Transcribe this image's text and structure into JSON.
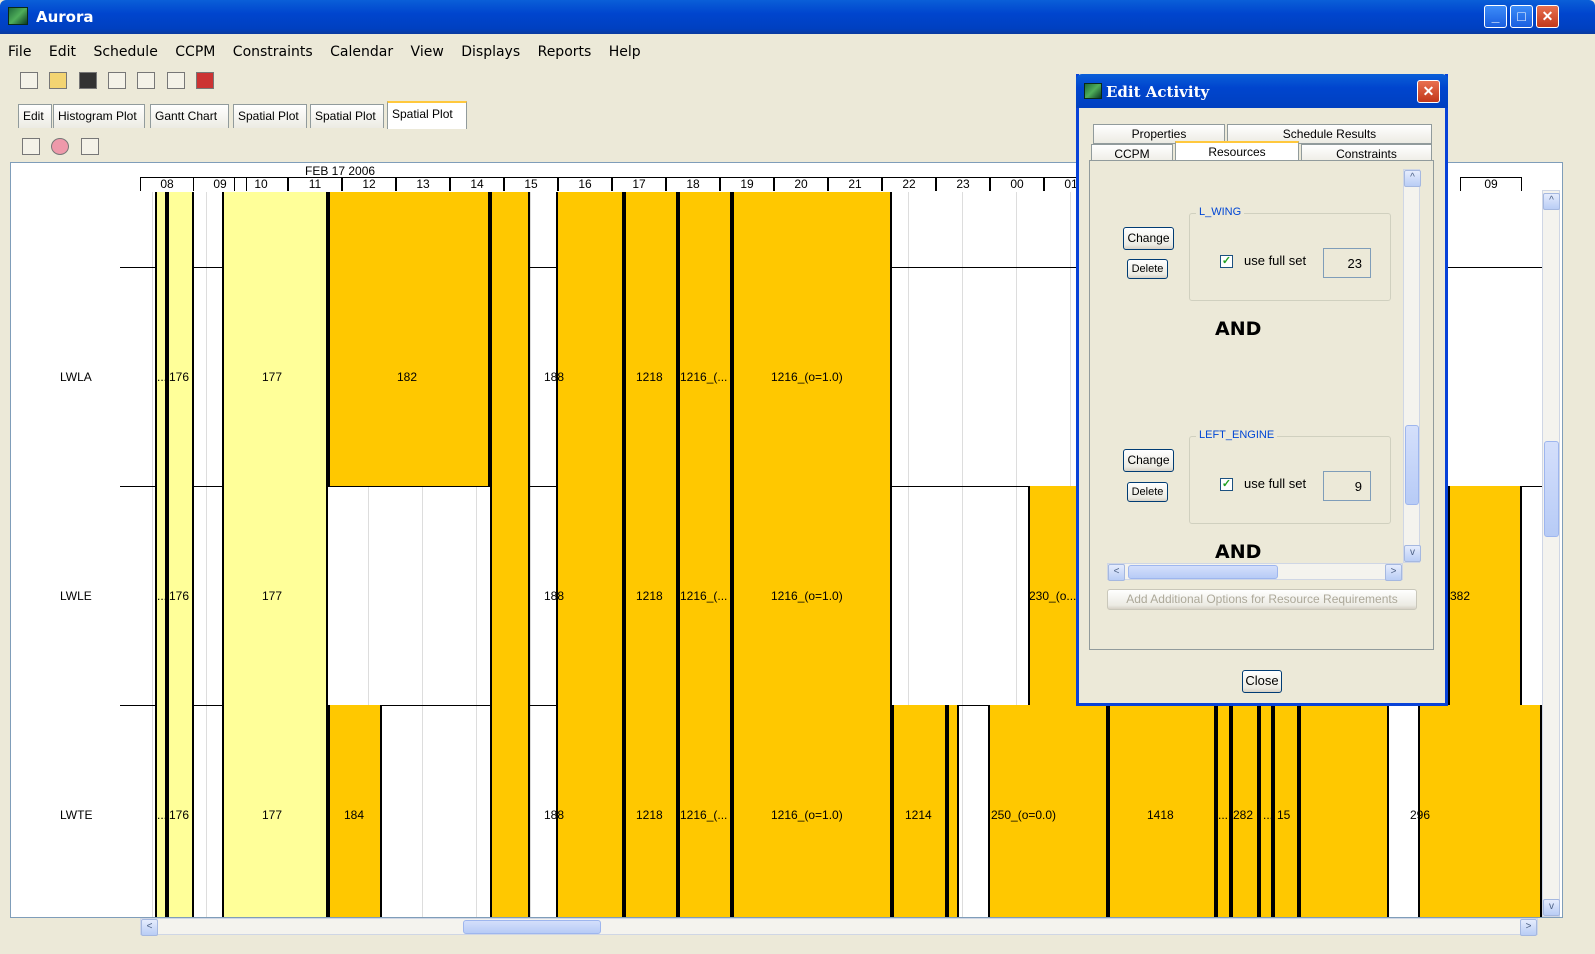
{
  "window": {
    "title": "Aurora"
  },
  "menu": [
    "File",
    "Edit",
    "Schedule",
    "CCPM",
    "Constraints",
    "Calendar",
    "View",
    "Displays",
    "Reports",
    "Help"
  ],
  "tabs": [
    "Edit",
    "Histogram Plot",
    "Gantt Chart",
    "Spatial Plot",
    "Spatial Plot",
    "Spatial Plot"
  ],
  "active_tab": "Spatial Plot",
  "plot": {
    "date": "FEB 17 2006",
    "hours": [
      "08",
      "09",
      "10",
      "11",
      "12",
      "13",
      "14",
      "15",
      "16",
      "17",
      "18",
      "19",
      "20",
      "21",
      "22",
      "23",
      "00",
      "01",
      "09"
    ],
    "rows": [
      {
        "name": "LWLA",
        "labels": [
          "176",
          "177",
          "182",
          "188",
          "1218",
          "1216_(...",
          "1216_(o=1.0)"
        ]
      },
      {
        "name": "LWLE",
        "labels": [
          "176",
          "177",
          "188",
          "1218",
          "1216_(...",
          "1216_(o=1.0)",
          "230_(o...",
          "382"
        ]
      },
      {
        "name": "LWTE",
        "labels": [
          "176",
          "177",
          "184",
          "188",
          "1218",
          "1216_(...",
          "1216_(o=1.0)",
          "1214",
          "250_(o=0.0)",
          "1418",
          "282",
          "15",
          "296"
        ]
      }
    ],
    "truncation_marker": "..."
  },
  "dialog": {
    "title": "Edit Activity",
    "tabs_row1": [
      "Properties",
      "Schedule Results"
    ],
    "tabs_row2": [
      "CCPM",
      "Resources",
      "Constraints"
    ],
    "active_tab": "Resources",
    "resources": [
      {
        "name": "L_WING",
        "change": "Change",
        "delete": "Delete",
        "use_full_set": "use full set",
        "checked": true,
        "value": "23"
      },
      {
        "name": "LEFT_ENGINE",
        "change": "Change",
        "delete": "Delete",
        "use_full_set": "use full set",
        "checked": true,
        "value": "9"
      }
    ],
    "and_label": "AND",
    "add_options": "Add Additional Options for Resource Requirements",
    "close": "Close"
  },
  "colors": {
    "block": "#FFC800",
    "light_block": "#FFFF99",
    "title_bar": "#0A5FD8"
  }
}
